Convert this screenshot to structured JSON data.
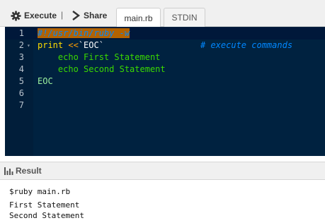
{
  "toolbar": {
    "execute_label": "Execute",
    "separator": "|",
    "share_label": "Share"
  },
  "tabs": [
    {
      "label": "main.rb",
      "active": true
    },
    {
      "label": "STDIN",
      "active": false
    }
  ],
  "editor": {
    "line_numbers": [
      "1",
      "2",
      "3",
      "4",
      "5",
      "6",
      "7"
    ],
    "lines": {
      "l1": {
        "shebang": "#!/usr/bin/ruby -w"
      },
      "l2": {
        "kw": "print",
        "op": " <<",
        "str": "`EOC`",
        "comment": "# execute commands"
      },
      "l3": {
        "text": "    echo First Statement"
      },
      "l4": {
        "text": "    echo Second Statement"
      },
      "l5": {
        "text": "EOC"
      }
    }
  },
  "result": {
    "label": "Result",
    "command": "$ruby main.rb",
    "output_lines": [
      "First Statement",
      "Second Statement"
    ]
  },
  "colors": {
    "editor_bg": "#002240",
    "keyword": "#ffdd00",
    "string": "#3ad900",
    "comment": "#0088ff"
  }
}
